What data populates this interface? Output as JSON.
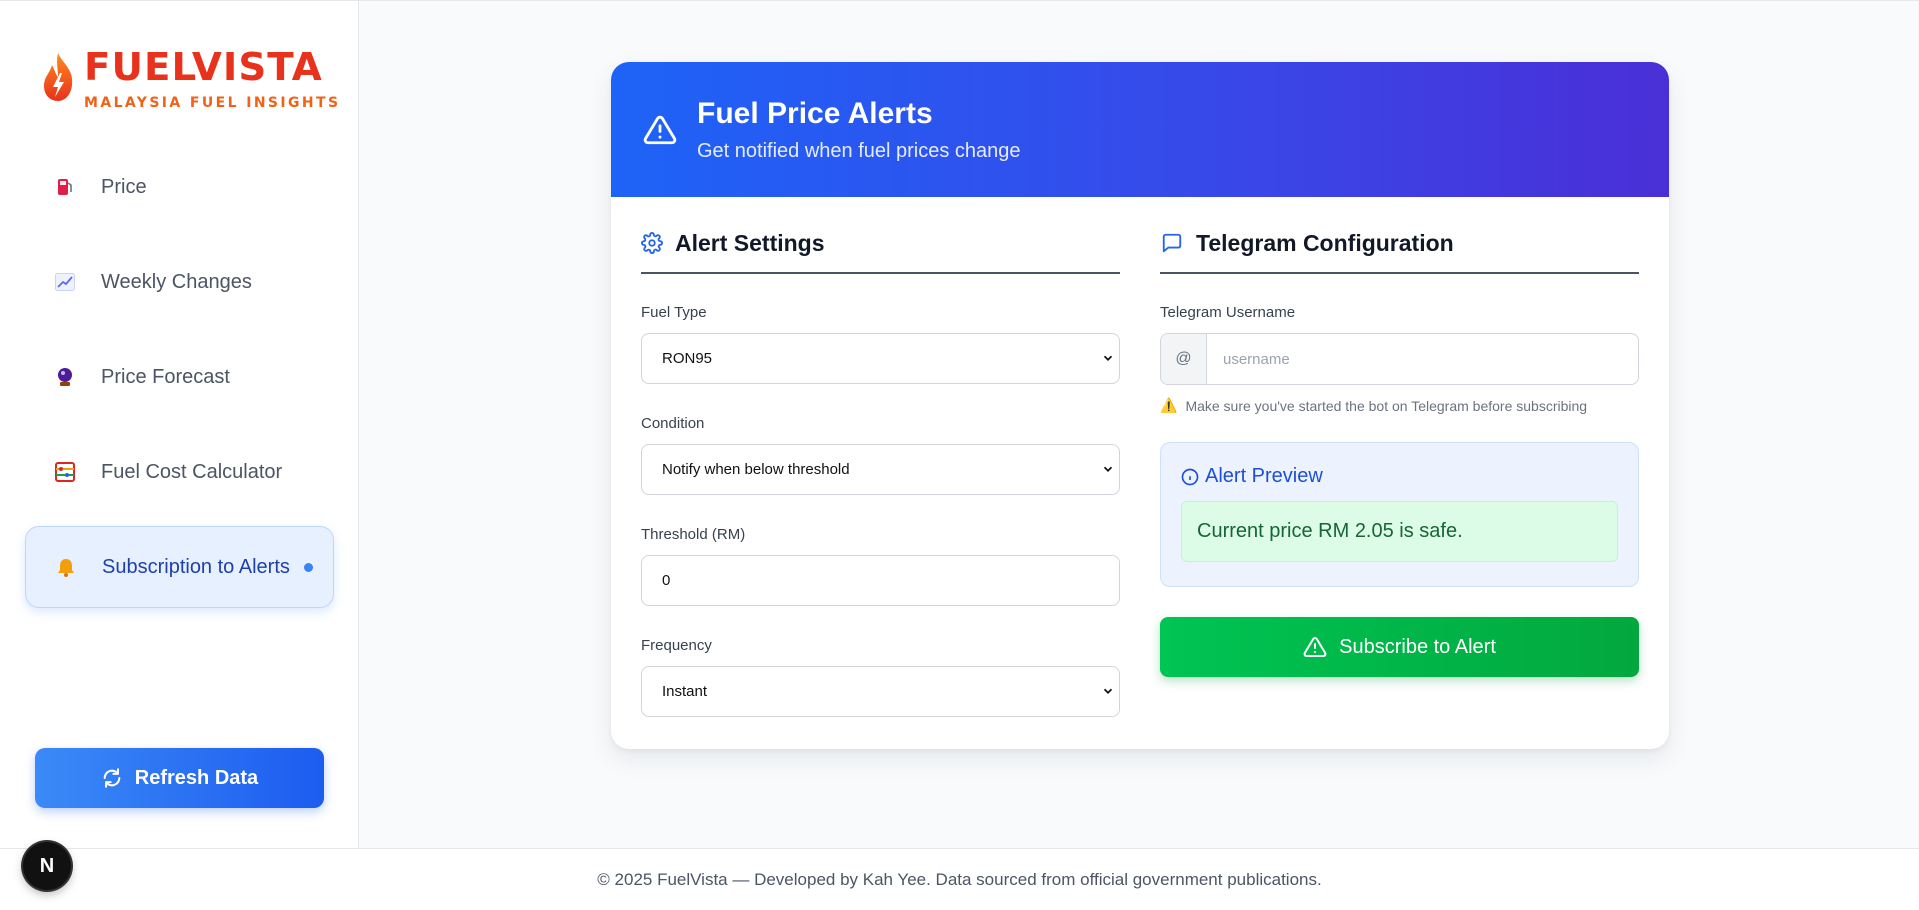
{
  "brand": {
    "title": "FUELVISTA",
    "subtitle": "MALAYSIA FUEL INSIGHTS",
    "colors": {
      "title": "#e8321c",
      "subtitle": "#f26216"
    }
  },
  "sidebar": {
    "items": [
      {
        "label": "Price",
        "icon": "fuel-pump-icon",
        "active": false
      },
      {
        "label": "Weekly Changes",
        "icon": "chart-increasing-icon",
        "active": false
      },
      {
        "label": "Price Forecast",
        "icon": "crystal-ball-icon",
        "active": false
      },
      {
        "label": "Fuel Cost Calculator",
        "icon": "abacus-icon",
        "active": false
      },
      {
        "label": "Subscription to Alerts",
        "icon": "bell-icon",
        "active": true
      }
    ],
    "refresh_label": "Refresh Data"
  },
  "card": {
    "title": "Fuel Price Alerts",
    "subtitle": "Get notified when fuel prices change",
    "alert_settings": {
      "title": "Alert Settings",
      "fuel_type_label": "Fuel Type",
      "fuel_type_value": "RON95",
      "condition_label": "Condition",
      "condition_value": "Notify when below threshold",
      "threshold_label": "Threshold (RM)",
      "threshold_value": "0",
      "frequency_label": "Frequency",
      "frequency_value": "Instant"
    },
    "telegram": {
      "title": "Telegram Configuration",
      "username_label": "Telegram Username",
      "at_symbol": "@",
      "username_placeholder": "username",
      "hint_icon": "⚠️",
      "hint": "Make sure you've started the bot on Telegram before subscribing"
    },
    "preview": {
      "title": "Alert Preview",
      "message": "Current price RM 2.05 is safe."
    },
    "subscribe_label": "Subscribe to Alert"
  },
  "footer": {
    "text": "© 2025 FuelVista — Developed by Kah Yee. Data sourced from official government publications."
  },
  "next_badge": "N"
}
